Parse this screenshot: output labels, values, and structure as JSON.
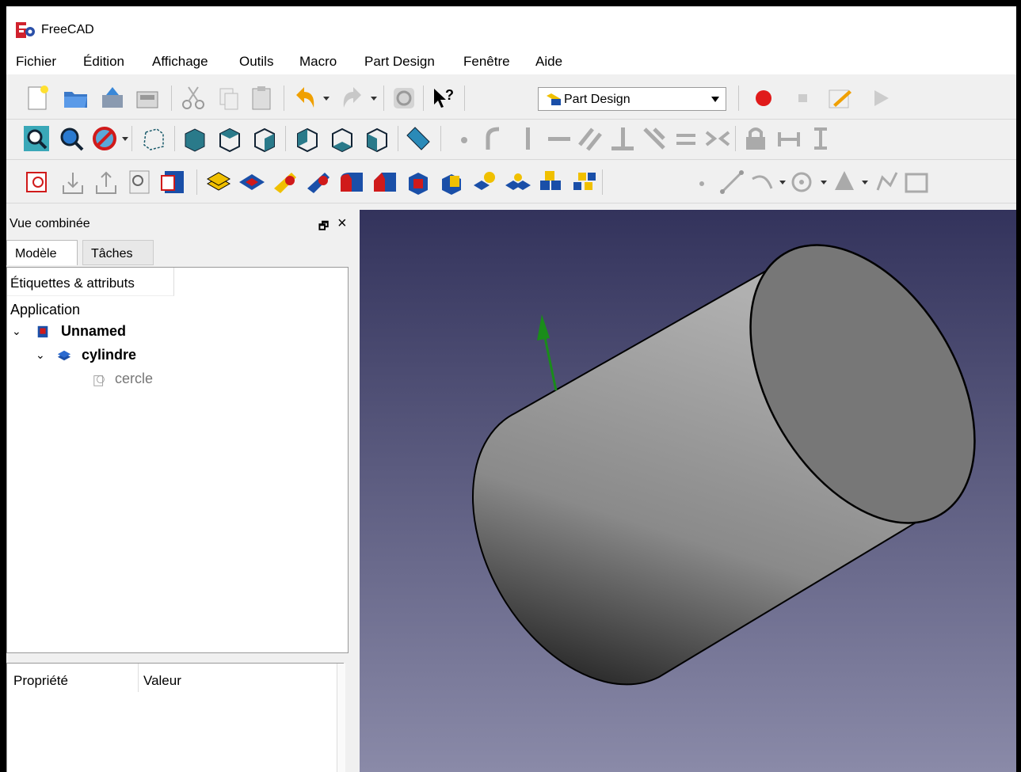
{
  "window": {
    "title": "FreeCAD",
    "logo_icon": "freecad-logo-icon"
  },
  "menubar": {
    "items": [
      "Fichier",
      "Édition",
      "Affichage",
      "Outils",
      "Macro",
      "Part Design",
      "Fenêtre",
      "Aide"
    ]
  },
  "toolbar": {
    "workbench": "Part Design",
    "icons_row1": [
      "new-document-icon",
      "open-document-icon",
      "save-icon",
      "save-as-icon",
      "cut-icon",
      "copy-icon",
      "paste-icon",
      "undo-icon",
      "redo-icon",
      "refresh-icon",
      "whats-this-icon",
      "macro-record-icon",
      "macro-stop-icon",
      "macro-edit-icon",
      "macro-execute-icon"
    ],
    "icons_row2": [
      "fit-all-icon",
      "fit-selection-icon",
      "draw-style-icon",
      "isometric-view-icon",
      "front-view-icon",
      "top-view-icon",
      "right-view-icon",
      "rear-view-icon",
      "bottom-view-icon",
      "left-view-icon",
      "measure-icon",
      "sketch-point-icon",
      "sketch-arc-icon",
      "constraint-vertical-icon",
      "constraint-horizontal-icon",
      "constraint-parallel-icon",
      "constraint-perpendicular-icon",
      "constraint-tangent-icon",
      "constraint-equal-icon",
      "constraint-symmetric-icon",
      "constraint-lock-icon",
      "constraint-horizontal-distance-icon",
      "constraint-vertical-distance-icon"
    ],
    "icons_row3": [
      "create-sketch-icon",
      "import-icon",
      "export-icon",
      "validate-sketch-icon",
      "map-sketch-icon",
      "pad-icon",
      "pocket-icon",
      "revolution-icon",
      "groove-icon",
      "fillet-icon",
      "chamfer-icon",
      "draft-icon",
      "thickness-icon",
      "mirrored-icon",
      "linear-pattern-icon",
      "polar-pattern-icon",
      "point-icon",
      "line-icon",
      "arc-icon",
      "circle-icon",
      "conic-icon",
      "polyline-icon",
      "rectangle-icon"
    ]
  },
  "combo_view": {
    "title": "Vue combinée",
    "tabs": [
      "Modèle",
      "Tâches"
    ],
    "tree_header": "Étiquettes & attributs",
    "tree_root": "Application",
    "tree": [
      {
        "label": "Unnamed",
        "icon": "document-icon",
        "bold": true
      },
      {
        "label": "cylindre",
        "icon": "pad-feature-icon",
        "bold": true
      },
      {
        "label": "cercle",
        "icon": "sketch-icon",
        "bold": false
      }
    ],
    "property_columns": [
      "Propriété",
      "Valeur"
    ]
  },
  "viewport": {
    "background_top": "#33335c",
    "background_bottom": "#8a8aa8",
    "object": "cylinder",
    "axis_color": "#1a8c1a"
  }
}
